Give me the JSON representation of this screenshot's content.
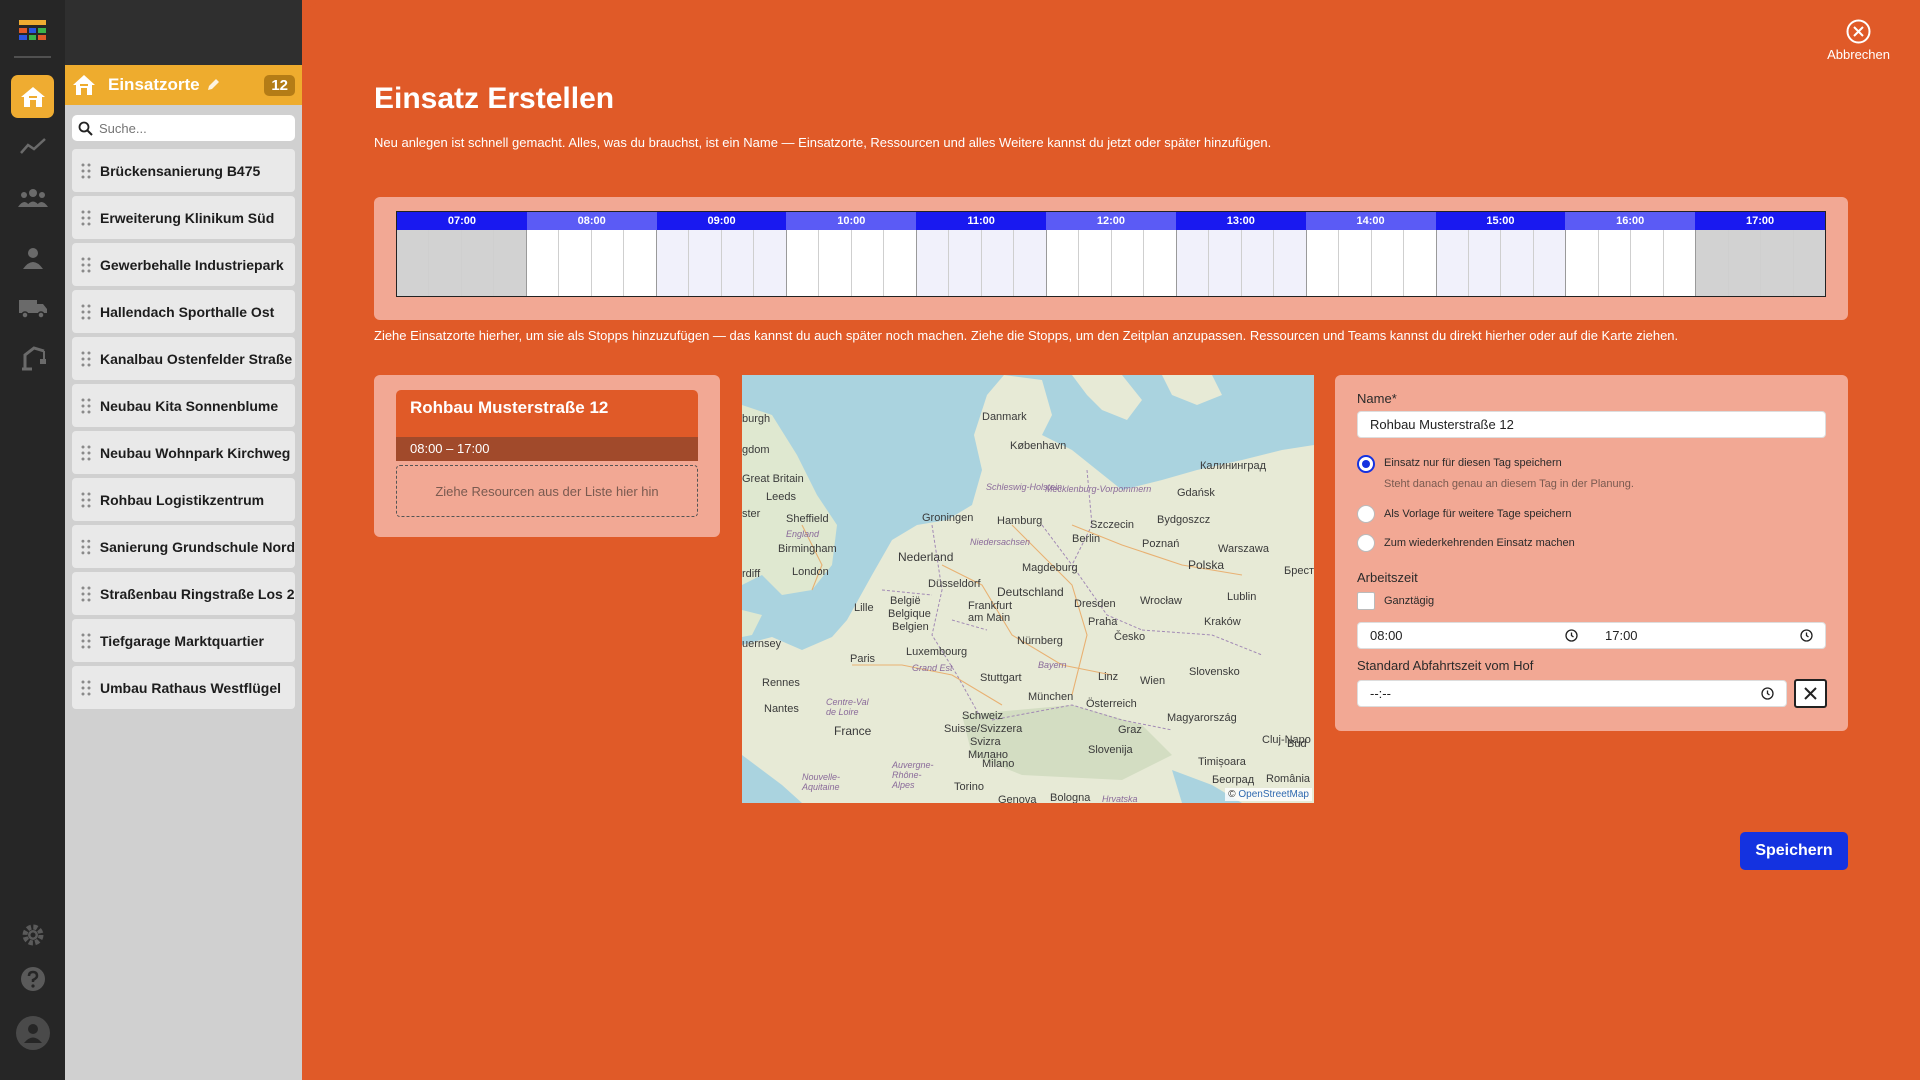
{
  "app": {
    "colors": {
      "accent": "#e05a28",
      "primary_button": "#1432e0",
      "sidebar_header": "#eeac2e"
    }
  },
  "rail": {
    "items": [
      {
        "icon": "app-logo-icon"
      },
      {
        "icon": "home-icon",
        "active": true
      },
      {
        "icon": "chart-icon"
      },
      {
        "icon": "teams-icon"
      },
      {
        "icon": "user-icon"
      },
      {
        "icon": "truck-icon"
      },
      {
        "icon": "crane-icon"
      },
      {
        "icon": "gear-icon"
      },
      {
        "icon": "help-icon"
      },
      {
        "icon": "avatar-icon"
      }
    ]
  },
  "sidebar": {
    "title": "Einsatzorte",
    "count": "12",
    "search_placeholder": "Suche...",
    "items": [
      "Brückensanierung B475",
      "Erweiterung Klinikum Süd",
      "Gewerbehalle Industriepark",
      "Hallendach Sporthalle Ost",
      "Kanalbau Ostenfelder Straße",
      "Neubau Kita Sonnenblume",
      "Neubau Wohnpark Kirchweg",
      "Rohbau Logistikzentrum",
      "Sanierung Grundschule Nord",
      "Straßenbau Ringstraße Los 2",
      "Tiefgarage Marktquartier",
      "Umbau Rathaus Westflügel"
    ]
  },
  "header": {
    "cancel_label": "Abbrechen",
    "title": "Einsatz Erstellen",
    "subtitle": "Neu anlegen ist schnell gemacht. Alles, was du brauchst, ist ein Name — Einsatzorte, Ressourcen und alles Weitere kannst du jetzt oder später hinzufügen."
  },
  "timeline": {
    "hours": [
      "07:00",
      "08:00",
      "09:00",
      "10:00",
      "11:00",
      "12:00",
      "13:00",
      "14:00",
      "15:00",
      "16:00",
      "17:00"
    ],
    "hint": "Ziehe Einsatzorte hierher, um sie als Stopps hinzuzufügen — das kannst du auch später noch machen. Ziehe die Stopps, um den Zeitplan anzupassen. Ressourcen und Teams kannst du direkt hierher oder auf die Karte ziehen."
  },
  "stop": {
    "name": "Rohbau Musterstraße 12",
    "time": "08:00 – 17:00",
    "drop_hint": "Ziehe Resourcen aus der Liste hier hin"
  },
  "map": {
    "labels": [
      "Danmark",
      "København",
      "Калининград",
      "Gdańsk",
      "Bydgoszcz",
      "Szczecin",
      "Hamburg",
      "Schleswig-Holstein",
      "Mecklenburg-Vorpommern",
      "Groningen",
      "Niedersachsen",
      "Berlin",
      "Poznań",
      "Warszawa",
      "Polska",
      "Nederland",
      "Magdeburg",
      "Sheffield",
      "Leeds",
      "Birmingham",
      "England",
      "London",
      "Great Britain",
      "burgh",
      "gdom",
      "ster",
      "rdiff",
      "Düsseldorf",
      "Deutschland",
      "Dresden",
      "Wrocław",
      "Lublin",
      "Брест",
      "België",
      "Belgique",
      "Belgien",
      "Lille",
      "Frankfurt am Main",
      "Česko",
      "Kraków",
      "Luxembourg",
      "Grand Est",
      "Nürnberg",
      "Praha",
      "uernsey",
      "Paris",
      "Stuttgart",
      "Bayern",
      "Linz",
      "Wien",
      "Slovensko",
      "Rennes",
      "Nantes",
      "Centre-Val de Loire",
      "München",
      "Österreich",
      "Magyarország",
      "Schweiz",
      "Suisse/Svizzera",
      "Svizra",
      "Graz",
      "France",
      "Slovenija",
      "Cluj-Napo",
      "Timișoara",
      "Милано",
      "Nouvelle-Aquitaine",
      "Auvergne-Rhône-Alpes",
      "Milano",
      "Torino",
      "Genova",
      "Bologna",
      "Hrvatska",
      "Београд",
      "România",
      "Bud"
    ],
    "attribution_prefix": "©",
    "attribution_link": "OpenStreetMap"
  },
  "form": {
    "name_label": "Name",
    "required_mark": "*",
    "name_value": "Rohbau Musterstraße 12",
    "option1": "Einsatz nur für diesen Tag speichern",
    "option1_sub": "Steht danach genau an diesem Tag in der Planung.",
    "option2": "Als Vorlage für weitere Tage speichern",
    "option3": "Zum wiederkehrenden Einsatz machen",
    "worktime_label": "Arbeitszeit",
    "allday_label": "Ganztägig",
    "start_time": "08:00",
    "end_time": "17:00",
    "departure_label": "Standard Abfahrtszeit vom Hof",
    "departure_value": "--:--",
    "save_label": "Speichern"
  }
}
